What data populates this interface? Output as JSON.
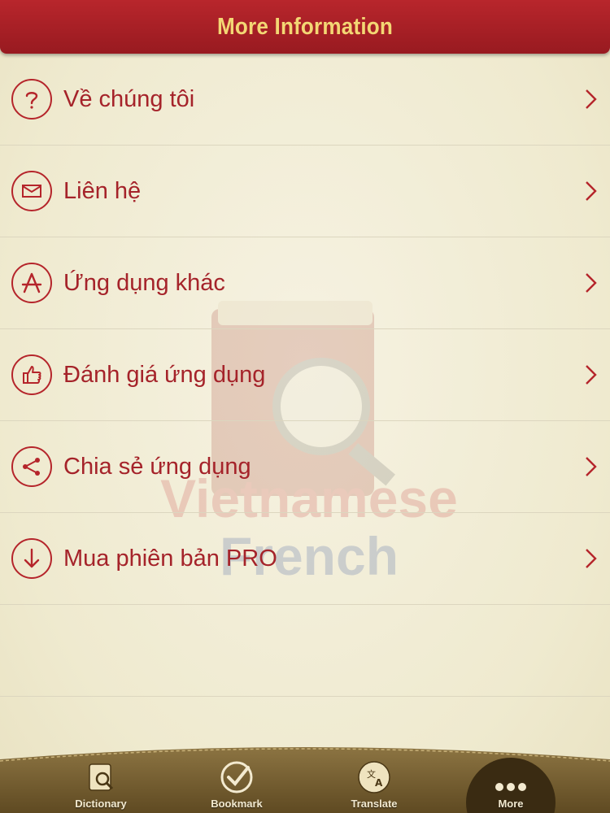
{
  "header": {
    "title": "More Information"
  },
  "menu": {
    "items": [
      {
        "label": "Về chúng tôi",
        "icon": "question-icon"
      },
      {
        "label": "Liên hệ",
        "icon": "envelope-icon"
      },
      {
        "label": "Ứng dụng khác",
        "icon": "app-store-icon"
      },
      {
        "label": "Đánh giá ứng dụng",
        "icon": "thumbs-up-icon"
      },
      {
        "label": "Chia sẻ ứng dụng",
        "icon": "share-icon"
      },
      {
        "label": "Mua phiên bản PRO",
        "icon": "download-icon"
      }
    ]
  },
  "watermark": {
    "line1": "Vietnamese",
    "line2": "French"
  },
  "tabbar": {
    "tabs": [
      {
        "label": "Dictionary",
        "icon": "dictionary-icon"
      },
      {
        "label": "Bookmark",
        "icon": "checkmark-icon"
      },
      {
        "label": "Translate",
        "icon": "translate-icon"
      },
      {
        "label": "More",
        "icon": "more-dots-icon",
        "selected": true
      }
    ]
  },
  "colors": {
    "header_bg": "#a8202a",
    "header_text": "#f3d774",
    "accent": "#b5252b",
    "background": "#f3efdc",
    "tabbar_bg": "#7a6238"
  }
}
